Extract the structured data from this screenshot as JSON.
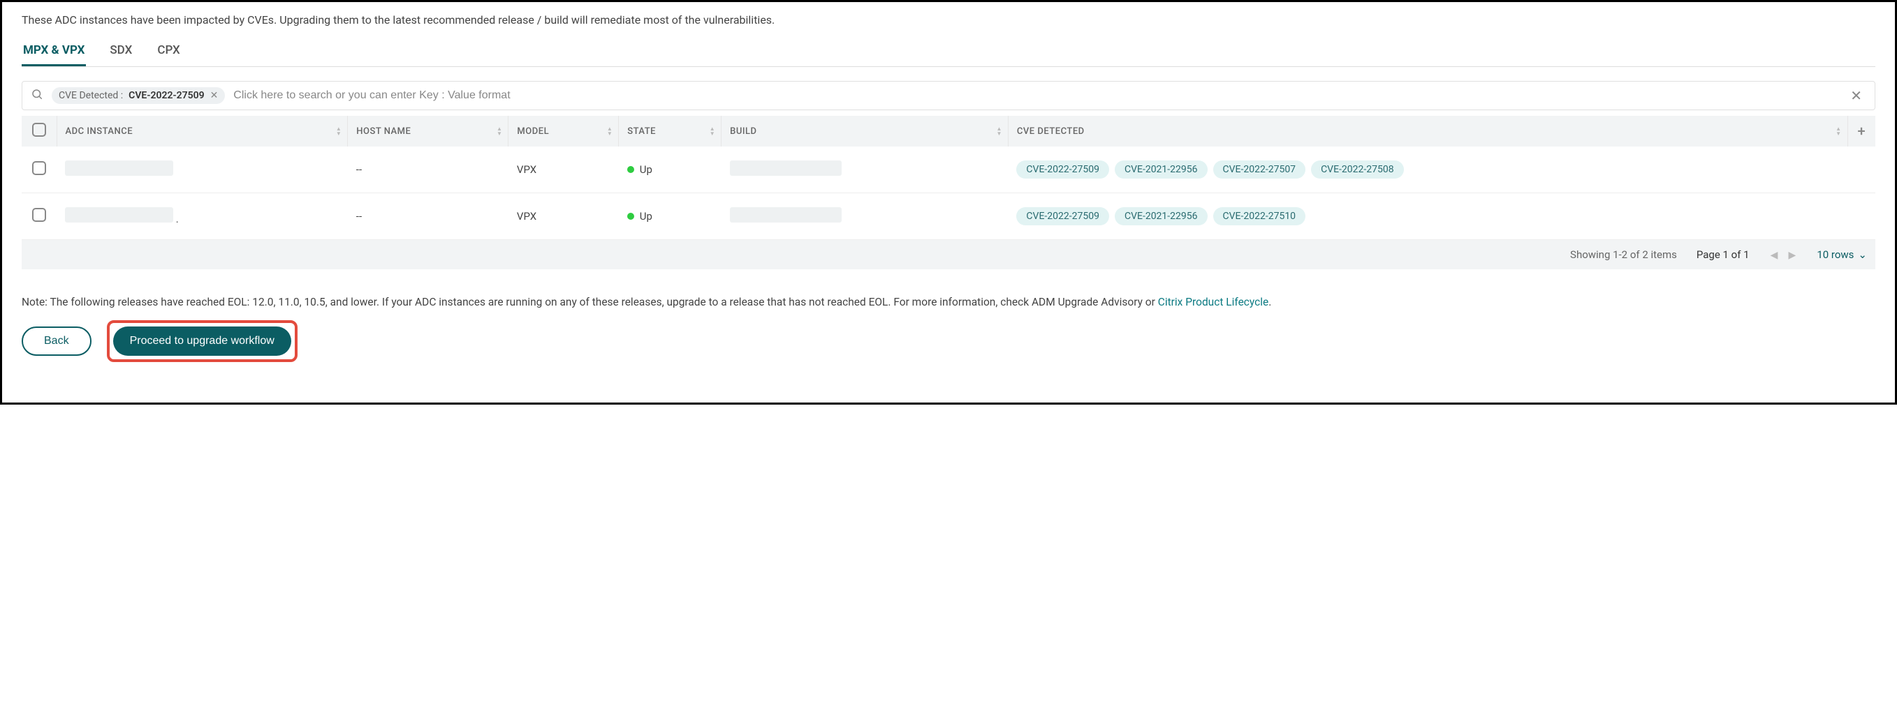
{
  "intro": "These ADC instances have been impacted by CVEs. Upgrading them to the latest recommended release / build will remediate most of the vulnerabilities.",
  "tabs": [
    {
      "label": "MPX & VPX",
      "active": true
    },
    {
      "label": "SDX",
      "active": false
    },
    {
      "label": "CPX",
      "active": false
    }
  ],
  "search": {
    "chip_label": "CVE Detected : ",
    "chip_value": "CVE-2022-27509",
    "placeholder": "Click here to search or you can enter Key : Value format"
  },
  "columns": {
    "adc_instance": "ADC INSTANCE",
    "host_name": "HOST NAME",
    "model": "MODEL",
    "state": "STATE",
    "build": "BUILD",
    "cve_detected": "CVE DETECTED"
  },
  "rows": [
    {
      "adc_instance": "",
      "host_name": "--",
      "model": "VPX",
      "state": "Up",
      "build": "",
      "cves": [
        "CVE-2022-27509",
        "CVE-2021-22956",
        "CVE-2022-27507",
        "CVE-2022-27508"
      ]
    },
    {
      "adc_instance": "",
      "host_name": "--",
      "model": "VPX",
      "state": "Up",
      "build": "",
      "cves": [
        "CVE-2022-27509",
        "CVE-2021-22956",
        "CVE-2022-27510"
      ]
    }
  ],
  "pager": {
    "showing": "Showing 1-2 of 2 items",
    "page": "Page 1 of 1",
    "rows": "10 rows"
  },
  "note_text_before_link": "Note: The following releases have reached EOL: 12.0, 11.0, 10.5, and lower. If your ADC instances are running on any of these releases, upgrade to a release that has not reached EOL. For more information, check ADM Upgrade Advisory or ",
  "note_link": "Citrix Product Lifecycle",
  "note_text_after_link": ".",
  "buttons": {
    "back": "Back",
    "proceed": "Proceed to upgrade workflow"
  }
}
